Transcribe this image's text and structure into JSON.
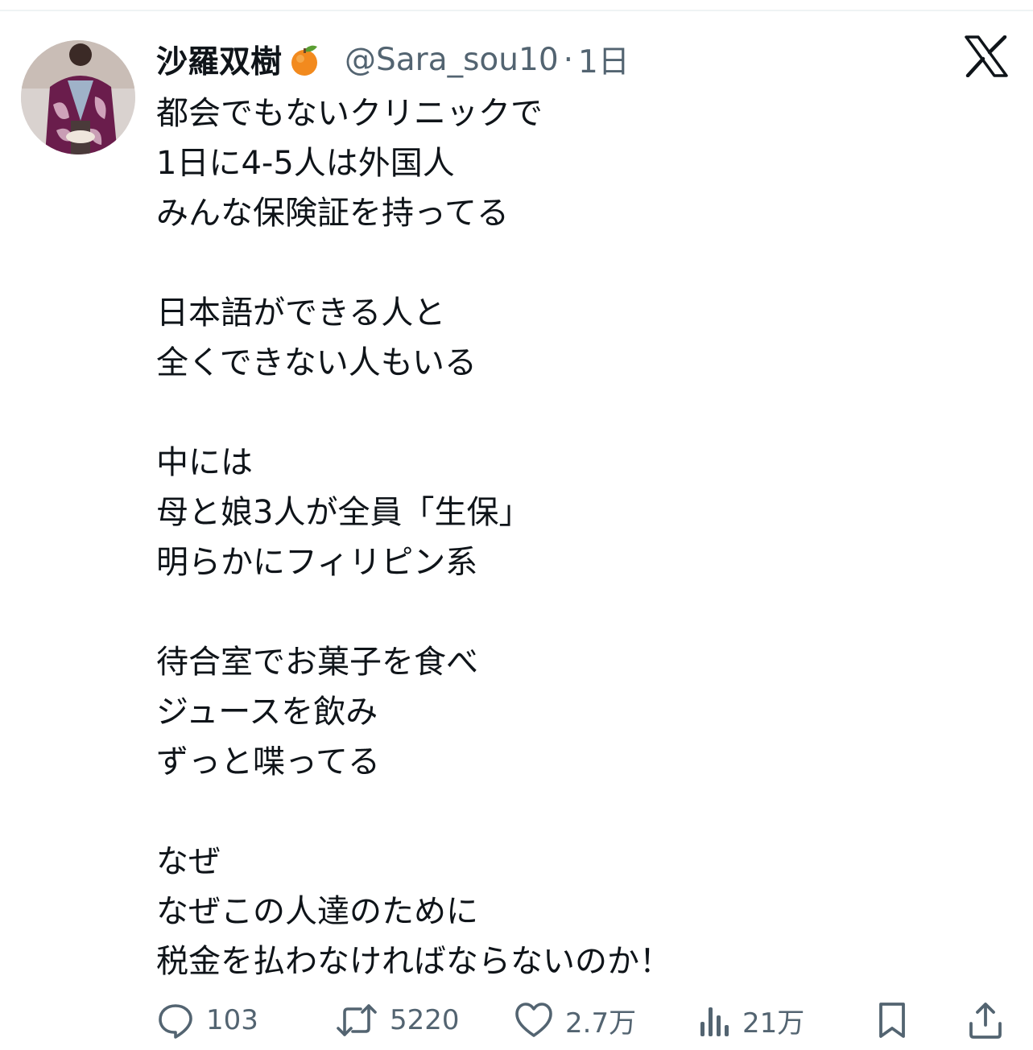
{
  "tweet": {
    "display_name": "沙羅双樹",
    "name_emoji": "tangerine-emoji",
    "handle": "@Sara_sou10",
    "separator": "·",
    "time": "1日",
    "platform_logo": "x-logo-icon",
    "lines": [
      "都会でもないクリニックで",
      "1日に4-5人は外国人",
      "みんな保険証を持ってる",
      "",
      "日本語ができる人と",
      "全くできない人もいる",
      "",
      "中には",
      "母と娘3人が全員「生保」",
      "明らかにフィリピン系",
      "",
      "待合室でお菓子を食べ",
      "ジュースを飲み",
      "ずっと喋ってる",
      "",
      "なぜ",
      "なぜこの人達のために",
      "税金を払わなければならないのか！"
    ]
  },
  "actions": {
    "reply": {
      "icon": "reply-icon",
      "count": "103"
    },
    "retweet": {
      "icon": "retweet-icon",
      "count": "5220"
    },
    "like": {
      "icon": "heart-icon",
      "count": "2.7万"
    },
    "views": {
      "icon": "views-icon",
      "count": "21万"
    },
    "bookmark": {
      "icon": "bookmark-icon"
    },
    "share": {
      "icon": "share-icon"
    }
  },
  "colors": {
    "text_primary": "#0f1419",
    "text_secondary": "#536471",
    "divider": "#eff3f4"
  }
}
